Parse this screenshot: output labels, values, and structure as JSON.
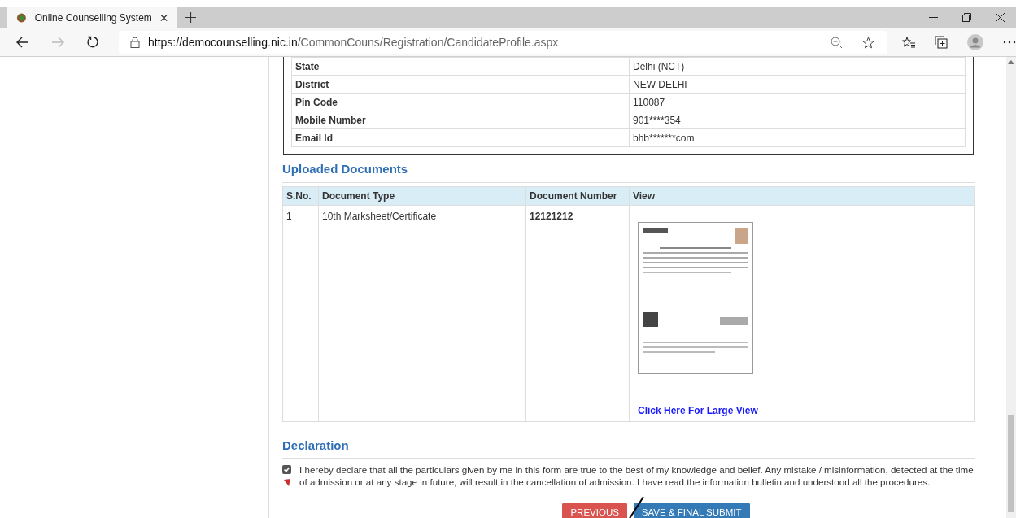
{
  "browser": {
    "tab_title": "Online Counselling System",
    "url_host": "https://democounselling.nic.in",
    "url_path": "/CommonCouns/Registration/CandidateProfile.aspx"
  },
  "profile_rows": [
    {
      "label": "State",
      "value": "Delhi (NCT)"
    },
    {
      "label": "District",
      "value": "NEW DELHI"
    },
    {
      "label": "Pin Code",
      "value": "110087"
    },
    {
      "label": "Mobile Number",
      "value": "901****354"
    },
    {
      "label": "Email Id",
      "value": "bhb*******com"
    }
  ],
  "uploaded_documents": {
    "title": "Uploaded Documents",
    "columns": [
      "S.No.",
      "Document Type",
      "Document Number",
      "View"
    ],
    "rows": [
      {
        "sno": "1",
        "document_type": "10th Marksheet/Certificate",
        "document_number": "12121212",
        "view_link": "Click Here For Large View"
      }
    ]
  },
  "declaration": {
    "title": "Declaration",
    "checked": true,
    "text": "I hereby declare that all the particulars given by me in this form are true to the best of my knowledge and belief. Any mistake / misinformation, detected at the time of admission or at any stage in future, will result in the cancellation of admission. I have read the information bulletin and understood all the procedures."
  },
  "buttons": [
    {
      "label": "PREVIOUS",
      "kind": "danger"
    },
    {
      "label": "SAVE & FINAL SUBMIT",
      "kind": "primary"
    }
  ]
}
